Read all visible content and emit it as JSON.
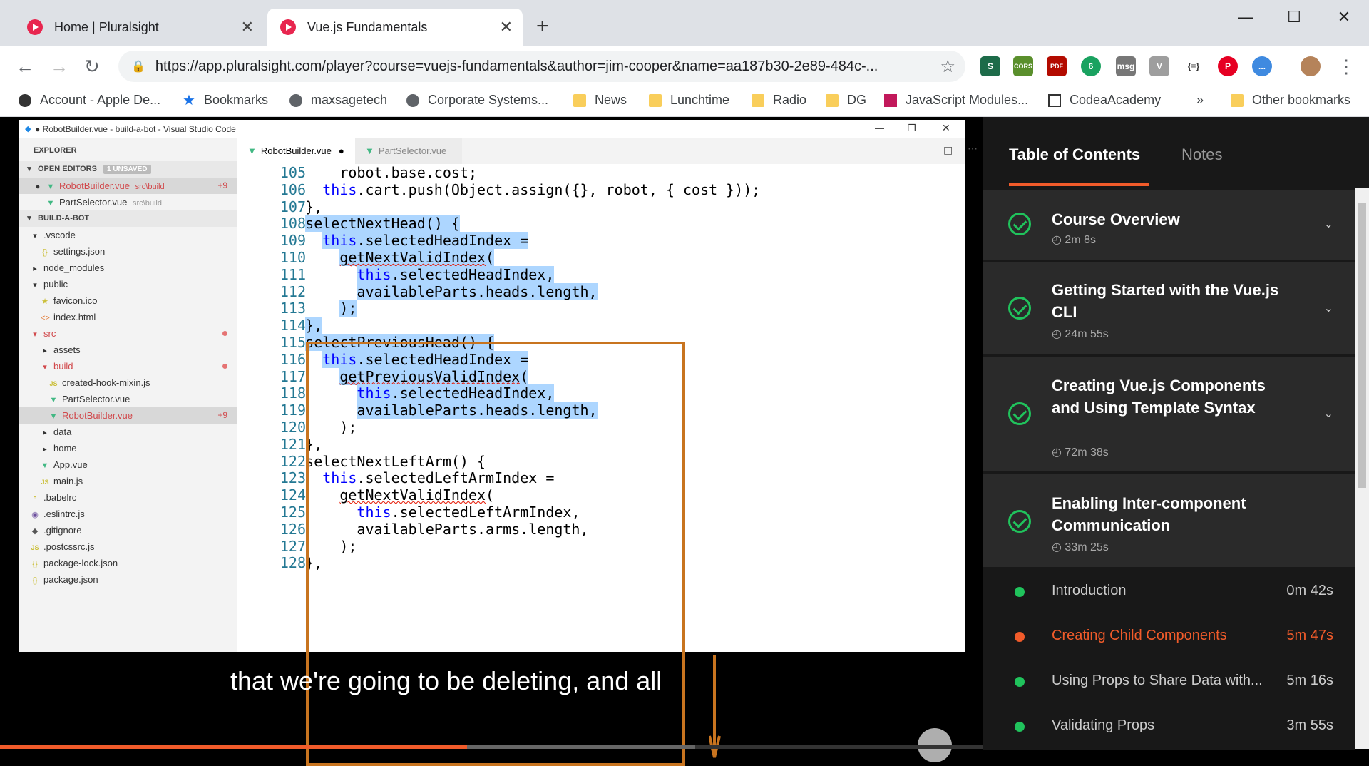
{
  "browser": {
    "tabs": [
      {
        "title": "Home | Pluralsight",
        "active": false
      },
      {
        "title": "Vue.js Fundamentals",
        "active": true
      }
    ],
    "url": "https://app.pluralsight.com/player?course=vuejs-fundamentals&author=jim-cooper&name=aa187b30-2e89-484c-...",
    "extensions": [
      "S",
      "CORS",
      "PDF",
      "6",
      "msg",
      "V",
      "{≡}",
      "P",
      "..."
    ],
    "bookmarks": [
      "Account - Apple De...",
      "Bookmarks",
      "maxsagetech",
      "Corporate Systems...",
      "News",
      "Lunchtime",
      "Radio",
      "DG",
      "JavaScript Modules...",
      "CodeaAcademy",
      "»",
      "Other bookmarks"
    ]
  },
  "vscode": {
    "title": "● RobotBuilder.vue - build-a-bot - Visual Studio Code",
    "explorer_label": "EXPLORER",
    "open_editors_label": "OPEN EDITORS",
    "unsaved_badge": "1 UNSAVED",
    "open_editors": [
      {
        "name": "RobotBuilder.vue",
        "path": "src\\build",
        "badge": "+9"
      },
      {
        "name": "PartSelector.vue",
        "path": "src\\build"
      }
    ],
    "project_label": "BUILD-A-BOT",
    "tree": [
      ".vscode",
      "settings.json",
      "node_modules",
      "public",
      "favicon.ico",
      "index.html",
      "src",
      "assets",
      "build",
      "created-hook-mixin.js",
      "PartSelector.vue",
      "RobotBuilder.vue",
      "data",
      "home",
      "App.vue",
      "main.js",
      ".babelrc",
      ".eslintrc.js",
      ".gitignore",
      ".postcssrc.js",
      "package-lock.json",
      "package.json"
    ],
    "tree_badge": "+9",
    "editor_tabs": [
      "RobotBuilder.vue",
      "PartSelector.vue"
    ],
    "line_numbers": [
      "105",
      "106",
      "107",
      "108",
      "109",
      "110",
      "111",
      "112",
      "113",
      "114",
      "115",
      "116",
      "117",
      "118",
      "119",
      "120",
      "121",
      "122",
      "123",
      "124",
      "125",
      "126",
      "127",
      "128"
    ],
    "code_lines": [
      "    robot.base.cost;",
      "  this.cart.push(Object.assign({}, robot, { cost }));",
      "},",
      "selectNextHead() {",
      "  this.selectedHeadIndex =",
      "    getNextValidIndex(",
      "      this.selectedHeadIndex,",
      "      availableParts.heads.length,",
      "    );",
      "},",
      "selectPreviousHead() {",
      "  this.selectedHeadIndex =",
      "    getPreviousValidIndex(",
      "      this.selectedHeadIndex,",
      "      availableParts.heads.length,",
      "    );",
      "},",
      "selectNextLeftArm() {",
      "  this.selectedLeftArmIndex =",
      "    getNextValidIndex(",
      "      this.selectedLeftArmIndex,",
      "      availableParts.arms.length,",
      "    );",
      "},"
    ]
  },
  "player": {
    "caption": "that we're going to be deleting, and all",
    "progress": 0.475
  },
  "toc": {
    "tabs": [
      "Table of Contents",
      "Notes"
    ],
    "modules": [
      {
        "title": "Course Overview",
        "duration": "2m 8s"
      },
      {
        "title": "Getting Started with the Vue.js CLI",
        "duration": "24m 55s"
      },
      {
        "title": "Creating Vue.js Components and Using Template Syntax",
        "duration": "72m 38s"
      },
      {
        "title": "Enabling Inter-component Communication",
        "duration": "33m 25s"
      }
    ],
    "clips": [
      {
        "title": "Introduction",
        "duration": "0m 42s",
        "state": "done"
      },
      {
        "title": "Creating Child Components",
        "duration": "5m 47s",
        "state": "current"
      },
      {
        "title": "Using Props to Share Data with...",
        "duration": "5m 16s",
        "state": "done"
      },
      {
        "title": "Validating Props",
        "duration": "3m 55s",
        "state": "done"
      }
    ]
  },
  "colors": {
    "accent": "#f15b2a",
    "check": "#20c35c",
    "highlight_box": "#c8741f",
    "selection": "#add6ff"
  }
}
